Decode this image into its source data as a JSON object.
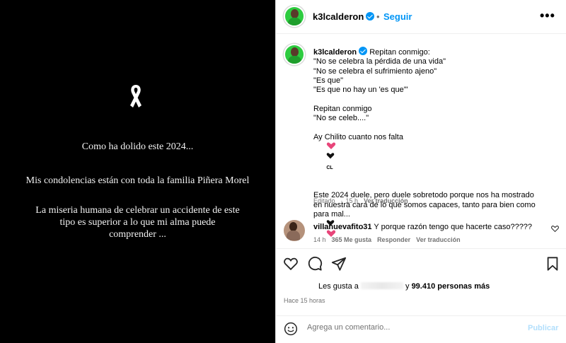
{
  "media": {
    "lines": [
      "Como ha dolido este 2024...",
      "Mis condolencias están con toda la familia Piñera Morel",
      "La miseria humana de celebrar un accidente de este tipo es superior a lo que mi alma puede comprender ..."
    ]
  },
  "header": {
    "username": "k3lcalderon",
    "separator": "•",
    "follow_label": "Seguir",
    "more_label": "•••"
  },
  "caption": {
    "username": "k3lcalderon",
    "lines": [
      "Repitan conmigo:",
      "\"No se celebra la pérdida de una vida\"",
      "\"No se celebra el sufrimiento ajeno\"",
      "\"Es que\"",
      "\"Es que no hay un 'es que'\"",
      "",
      "Repitan conmigo",
      "\"No se celeb....\"",
      "",
      "Ay Chilito cuanto nos falta",
      "",
      "Este 2024 duele, pero duele sobretodo porque nos ha mostrado",
      "en nuestra cara de lo que somos capaces, tanto para bien como",
      "para mal..."
    ],
    "flag_text": "CL",
    "edited": "Editado",
    "time": "15 h",
    "see_translation": "Ver traducción"
  },
  "reply": {
    "username": "villanuevafito31",
    "text": "Y porque razón tengo que hacerte caso?????",
    "time": "14 h",
    "likes": "365 Me gusta",
    "reply_label": "Responder",
    "see_translation": "Ver traducción"
  },
  "likes": {
    "prefix": "Les gusta a",
    "middle": "y",
    "count": "99.410 personas más"
  },
  "posted_ago": "Hace 15 horas",
  "comment": {
    "placeholder": "Agrega un comentario...",
    "publish_label": "Publicar"
  },
  "colors": {
    "accent": "#0095f6",
    "media_bg": "#000000",
    "heart_pink": "#e8457a"
  },
  "icons": [
    "ribbon-icon",
    "verified-icon",
    "heart-icon",
    "comment-icon",
    "share-icon",
    "bookmark-icon",
    "emoji-icon"
  ]
}
